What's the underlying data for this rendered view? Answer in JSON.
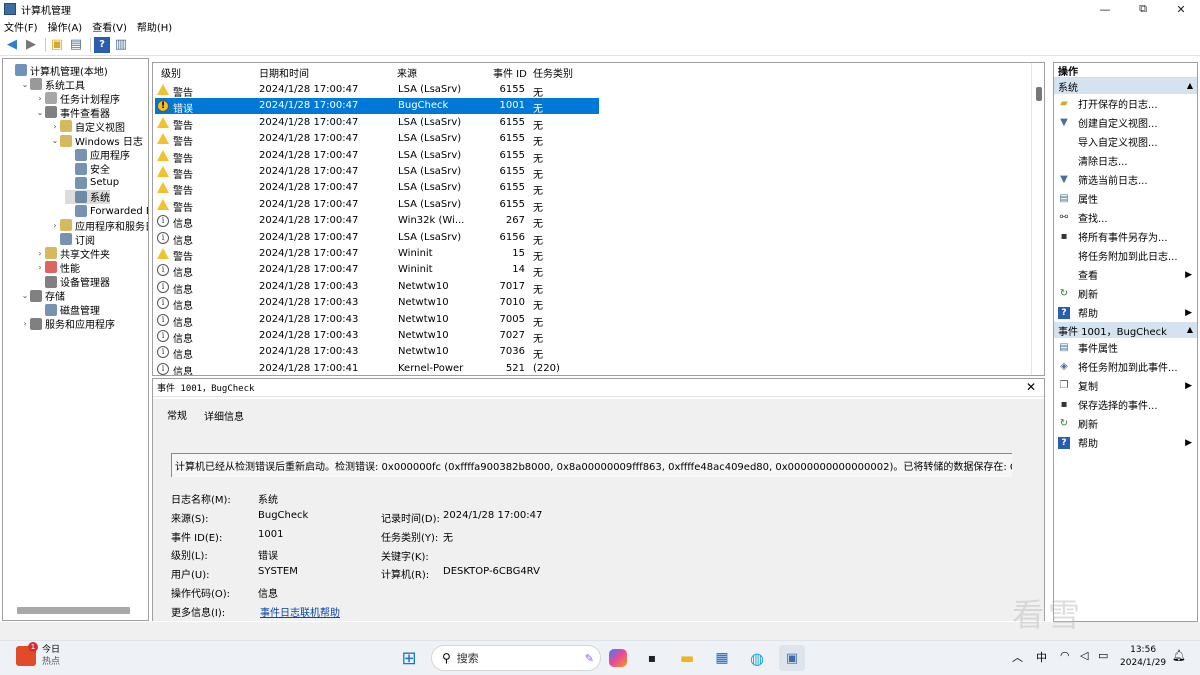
{
  "window": {
    "title": "计算机管理",
    "controls": {
      "minimize": "—",
      "maximize": "⧉",
      "close": "✕"
    }
  },
  "menu": [
    "文件(F)",
    "操作(A)",
    "查看(V)",
    "帮助(H)"
  ],
  "toolbar": {
    "icons": [
      "back-arrow-icon",
      "forward-arrow-icon",
      "folder-up-icon",
      "show-hide-tree-icon",
      "help-icon",
      "console-icon"
    ]
  },
  "tree": [
    {
      "label": "计算机管理(本地)",
      "depth": 0,
      "expander": ""
    },
    {
      "label": "系统工具",
      "depth": 1,
      "expander": "⌄"
    },
    {
      "label": "任务计划程序",
      "depth": 2,
      "expander": "›"
    },
    {
      "label": "事件查看器",
      "depth": 2,
      "expander": "⌄"
    },
    {
      "label": "自定义视图",
      "depth": 3,
      "expander": "›"
    },
    {
      "label": "Windows 日志",
      "depth": 3,
      "expander": "⌄"
    },
    {
      "label": "应用程序",
      "depth": 4,
      "expander": ""
    },
    {
      "label": "安全",
      "depth": 4,
      "expander": ""
    },
    {
      "label": "Setup",
      "depth": 4,
      "expander": ""
    },
    {
      "label": "系统",
      "depth": 4,
      "expander": "",
      "selected": true
    },
    {
      "label": "Forwarded Even",
      "depth": 4,
      "expander": ""
    },
    {
      "label": "应用程序和服务日志",
      "depth": 3,
      "expander": "›"
    },
    {
      "label": "订阅",
      "depth": 3,
      "expander": ""
    },
    {
      "label": "共享文件夹",
      "depth": 2,
      "expander": "›"
    },
    {
      "label": "性能",
      "depth": 2,
      "expander": "›"
    },
    {
      "label": "设备管理器",
      "depth": 2,
      "expander": ""
    },
    {
      "label": "存储",
      "depth": 1,
      "expander": "⌄"
    },
    {
      "label": "磁盘管理",
      "depth": 2,
      "expander": ""
    },
    {
      "label": "服务和应用程序",
      "depth": 1,
      "expander": "›"
    }
  ],
  "events": {
    "columns": [
      "级别",
      "日期和时间",
      "来源",
      "事件 ID",
      "任务类别"
    ],
    "rows": [
      {
        "level": "警告",
        "type": "warn",
        "datetime": "2024/1/28 17:00:47",
        "source": "LSA (LsaSrv)",
        "id": "6155",
        "category": "无"
      },
      {
        "level": "错误",
        "type": "err",
        "datetime": "2024/1/28 17:00:47",
        "source": "BugCheck",
        "id": "1001",
        "category": "无",
        "selected": true
      },
      {
        "level": "警告",
        "type": "warn",
        "datetime": "2024/1/28 17:00:47",
        "source": "LSA (LsaSrv)",
        "id": "6155",
        "category": "无"
      },
      {
        "level": "警告",
        "type": "warn",
        "datetime": "2024/1/28 17:00:47",
        "source": "LSA (LsaSrv)",
        "id": "6155",
        "category": "无"
      },
      {
        "level": "警告",
        "type": "warn",
        "datetime": "2024/1/28 17:00:47",
        "source": "LSA (LsaSrv)",
        "id": "6155",
        "category": "无"
      },
      {
        "level": "警告",
        "type": "warn",
        "datetime": "2024/1/28 17:00:47",
        "source": "LSA (LsaSrv)",
        "id": "6155",
        "category": "无"
      },
      {
        "level": "警告",
        "type": "warn",
        "datetime": "2024/1/28 17:00:47",
        "source": "LSA (LsaSrv)",
        "id": "6155",
        "category": "无"
      },
      {
        "level": "警告",
        "type": "warn",
        "datetime": "2024/1/28 17:00:47",
        "source": "LSA (LsaSrv)",
        "id": "6155",
        "category": "无"
      },
      {
        "level": "信息",
        "type": "info",
        "datetime": "2024/1/28 17:00:47",
        "source": "Win32k (Wi...",
        "id": "267",
        "category": "无"
      },
      {
        "level": "信息",
        "type": "info",
        "datetime": "2024/1/28 17:00:47",
        "source": "LSA (LsaSrv)",
        "id": "6156",
        "category": "无"
      },
      {
        "level": "警告",
        "type": "warn",
        "datetime": "2024/1/28 17:00:47",
        "source": "Wininit",
        "id": "15",
        "category": "无"
      },
      {
        "level": "信息",
        "type": "info",
        "datetime": "2024/1/28 17:00:47",
        "source": "Wininit",
        "id": "14",
        "category": "无"
      },
      {
        "level": "信息",
        "type": "info",
        "datetime": "2024/1/28 17:00:43",
        "source": "Netwtw10",
        "id": "7017",
        "category": "无"
      },
      {
        "level": "信息",
        "type": "info",
        "datetime": "2024/1/28 17:00:43",
        "source": "Netwtw10",
        "id": "7010",
        "category": "无"
      },
      {
        "level": "信息",
        "type": "info",
        "datetime": "2024/1/28 17:00:43",
        "source": "Netwtw10",
        "id": "7005",
        "category": "无"
      },
      {
        "level": "信息",
        "type": "info",
        "datetime": "2024/1/28 17:00:43",
        "source": "Netwtw10",
        "id": "7027",
        "category": "无"
      },
      {
        "level": "信息",
        "type": "info",
        "datetime": "2024/1/28 17:00:43",
        "source": "Netwtw10",
        "id": "7036",
        "category": "无"
      },
      {
        "level": "信息",
        "type": "info",
        "datetime": "2024/1/28 17:00:41",
        "source": "Kernel-Power",
        "id": "521",
        "category": "(220)"
      }
    ]
  },
  "detail": {
    "header": "事件 1001，BugCheck",
    "tabs": [
      "常规",
      "详细信息"
    ],
    "message": "计算机已经从检测错误后重新启动。检测错误: 0x000000fc (0xffffa900382b8000, 0x8a00000009fff863, 0xffffe48ac409ed80, 0x0000000000000002)。已将转储的数据保存在: C:\\WINDOWS",
    "fields_left": [
      {
        "label": "日志名称(M):",
        "value": "系统"
      },
      {
        "label": "来源(S):",
        "value": "BugCheck"
      },
      {
        "label": "事件 ID(E):",
        "value": "1001"
      },
      {
        "label": "级别(L):",
        "value": "错误"
      },
      {
        "label": "用户(U):",
        "value": "SYSTEM"
      },
      {
        "label": "操作代码(O):",
        "value": "信息"
      },
      {
        "label": "更多信息(I):",
        "value": "事件日志联机帮助"
      }
    ],
    "fields_right": [
      {
        "label": "记录时间(D):",
        "value": "2024/1/28 17:00:47"
      },
      {
        "label": "任务类别(Y):",
        "value": "无"
      },
      {
        "label": "关键字(K):",
        "value": ""
      },
      {
        "label": "计算机(R):",
        "value": "DESKTOP-6CBG4RV"
      }
    ]
  },
  "actions": {
    "title": "操作",
    "group1": "系统",
    "items1": [
      {
        "label": "打开保存的日志...",
        "icon": "open-folder-icon"
      },
      {
        "label": "创建自定义视图...",
        "icon": "filter-icon"
      },
      {
        "label": "导入自定义视图...",
        "icon": ""
      },
      {
        "label": "清除日志...",
        "icon": ""
      },
      {
        "label": "筛选当前日志...",
        "icon": "filter-icon"
      },
      {
        "label": "属性",
        "icon": "properties-icon"
      },
      {
        "label": "查找...",
        "icon": "find-icon"
      },
      {
        "label": "将所有事件另存为...",
        "icon": "save-icon"
      },
      {
        "label": "将任务附加到此日志...",
        "icon": ""
      },
      {
        "label": "查看",
        "icon": "",
        "submenu": true
      },
      {
        "label": "刷新",
        "icon": "refresh-icon"
      },
      {
        "label": "帮助",
        "icon": "help-icon",
        "submenu": true
      }
    ],
    "group2": "事件 1001，BugCheck",
    "items2": [
      {
        "label": "事件属性",
        "icon": "event-properties-icon"
      },
      {
        "label": "将任务附加到此事件...",
        "icon": "attach-task-icon"
      },
      {
        "label": "复制",
        "icon": "copy-icon",
        "submenu": true
      },
      {
        "label": "保存选择的事件...",
        "icon": "save-icon"
      },
      {
        "label": "刷新",
        "icon": "refresh-icon"
      },
      {
        "label": "帮助",
        "icon": "help-icon",
        "submenu": true
      }
    ]
  },
  "taskbar": {
    "weather_title": "今日",
    "weather_sub": "热点",
    "weather_badge": "1",
    "search_placeholder": "搜索",
    "ime": "中",
    "time": "13:56",
    "date": "2024/1/29"
  },
  "watermark": "看雪"
}
